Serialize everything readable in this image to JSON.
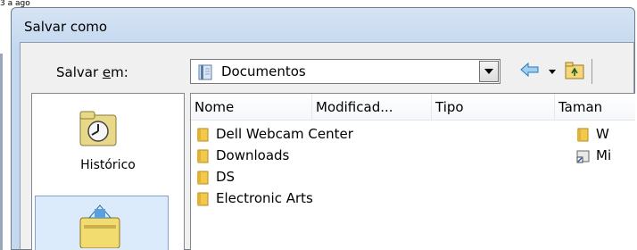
{
  "dialog": {
    "title": "Salvar como",
    "save_in_label_prefix": "Salvar ",
    "save_in_label_accel": "e",
    "save_in_label_suffix": "m:",
    "location": "Documentos"
  },
  "places": [
    {
      "label": "Histórico",
      "icon": "history-icon"
    },
    {
      "label": "",
      "icon": "desktop-icon",
      "selected": true
    }
  ],
  "columns": [
    "Nome",
    "Modificad...",
    "Tipo",
    "Taman"
  ],
  "files": [
    {
      "name": "Dell Webcam Center",
      "icon": "folder-icon"
    },
    {
      "name": "Downloads",
      "icon": "folder-icon"
    },
    {
      "name": "DS",
      "icon": "folder-icon"
    },
    {
      "name": "Electronic Arts",
      "icon": "folder-icon"
    }
  ],
  "right_column_items": [
    {
      "name": "W",
      "icon": "folder-icon"
    },
    {
      "name": "Mi",
      "icon": "shortcut-icon"
    }
  ],
  "top_sliver_text": "3 a ago"
}
